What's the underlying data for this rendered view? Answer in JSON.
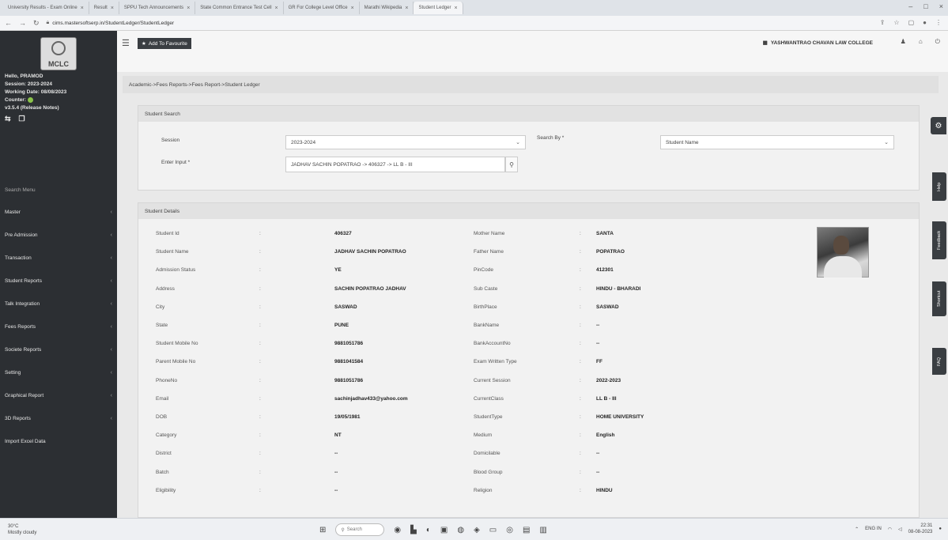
{
  "browser": {
    "tabs": [
      "University Results - Exam Online",
      "Result",
      "SPPU Tech Announcements",
      "State Common Entrance Test Cell",
      "GR For College Level Office",
      "Marathi Wikipedia",
      "Student Ledger"
    ],
    "url": "cims.mastersoftserp.in/StudentLedger/StudentLedger"
  },
  "sidebar": {
    "logo_text": "MCLC",
    "user_lines": [
      "Hello, PRAMOD",
      "Session: 2023-2024",
      "Working Date: 08/08/2023",
      "Counter:",
      "v3.5.4 (Release Notes)"
    ],
    "menu_heading": "Search Menu",
    "items": [
      "Master",
      "Pre Admission",
      "Transaction",
      "Student Reports",
      "Talk Integration",
      "Fees Reports",
      "Societe Reports",
      "Setting",
      "Graphical Report",
      "3D Reports",
      "Import Excel Data"
    ]
  },
  "topbar": {
    "favourite_label": "Add To Favourite",
    "college_name": "YASHWANTRAO CHAVAN LAW COLLEGE"
  },
  "breadcrumb": "Academic->Fees Reports->Fees Report->Student Ledger",
  "search_panel": {
    "title": "Student Search",
    "session_label": "Session",
    "session_value": "2023-2024",
    "search_by_label": "Search By *",
    "search_by_value": "Student Name",
    "enter_input_label": "Enter Input *",
    "enter_input_value": "JADHAV SACHIN POPATRAO -> 406327 -> LL B - III"
  },
  "details_panel": {
    "title": "Student Details",
    "left_rows": [
      {
        "label": "Student Id",
        "value": "406327"
      },
      {
        "label": "Student Name",
        "value": "JADHAV SACHIN POPATRAO"
      },
      {
        "label": "Admission Status",
        "value": "YE"
      },
      {
        "label": "Address",
        "value": "SACHIN POPATRAO JADHAV"
      },
      {
        "label": "City",
        "value": "SASWAD"
      },
      {
        "label": "State",
        "value": "PUNE"
      },
      {
        "label": "Student Mobile No",
        "value": "9881051786"
      },
      {
        "label": "Parent Mobile No",
        "value": "9881041584"
      },
      {
        "label": "PhoneNo",
        "value": "9881051786"
      },
      {
        "label": "Email",
        "value": "sachinjadhav433@yahoo.com"
      },
      {
        "label": "DOB",
        "value": "19/05/1981"
      },
      {
        "label": "Category",
        "value": "NT"
      },
      {
        "label": "District",
        "value": "--"
      },
      {
        "label": "Batch",
        "value": "--"
      },
      {
        "label": "Eligibility",
        "value": "--"
      }
    ],
    "right_rows": [
      {
        "label": "Mother Name",
        "value": "SANTA"
      },
      {
        "label": "Father Name",
        "value": "POPATRAO"
      },
      {
        "label": "PinCode",
        "value": "412301"
      },
      {
        "label": "Sub Caste",
        "value": "HINDU - BHARADI"
      },
      {
        "label": "BirthPlace",
        "value": "SASWAD"
      },
      {
        "label": "BankName",
        "value": "--"
      },
      {
        "label": "BankAccountNo",
        "value": "--"
      },
      {
        "label": "Exam Written Type",
        "value": "FF"
      },
      {
        "label": "Current Session",
        "value": "2022-2023"
      },
      {
        "label": "CurrentClass",
        "value": "LL B - III"
      },
      {
        "label": "StudentType",
        "value": "HOME UNIVERSITY"
      },
      {
        "label": "Medium",
        "value": "English"
      },
      {
        "label": "Domicilable",
        "value": "--"
      },
      {
        "label": "Blood Group",
        "value": "--"
      },
      {
        "label": "Religion",
        "value": "HINDU"
      }
    ]
  },
  "side_tabs": [
    "Help",
    "Feedback",
    "Shortcut",
    "FAQ"
  ],
  "taskbar": {
    "weather_temp": "30°C",
    "weather_desc": "Mostly cloudy",
    "search_placeholder": "Search",
    "lang": "ENG IN",
    "time": "22:31",
    "date": "08-08-2023"
  }
}
